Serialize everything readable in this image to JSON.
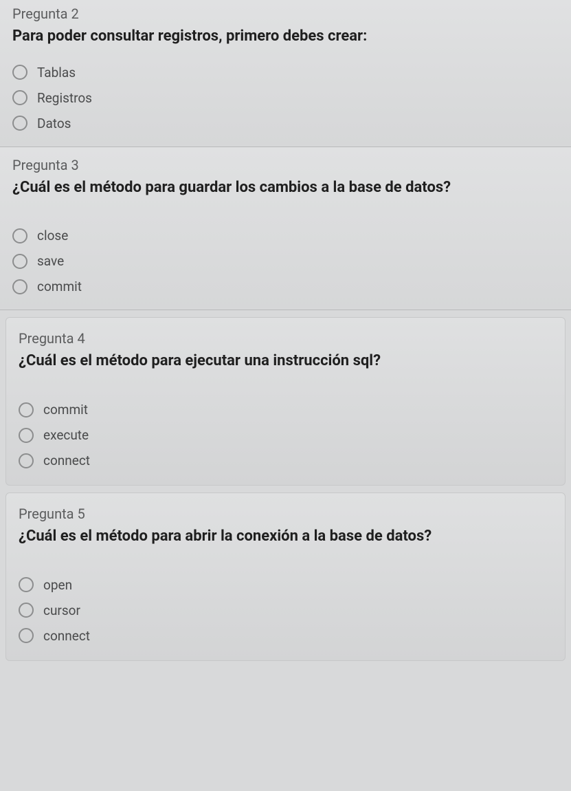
{
  "questions": [
    {
      "number": "Pregunta 2",
      "text": "Para poder consultar registros, primero debes crear:",
      "options": [
        "Tablas",
        "Registros",
        "Datos"
      ]
    },
    {
      "number": "Pregunta 3",
      "text": "¿Cuál es el método para guardar los cambios a la base de datos?",
      "options": [
        "close",
        "save",
        "commit"
      ]
    },
    {
      "number": "Pregunta 4",
      "text": "¿Cuál es el método para ejecutar una instrucción sql?",
      "options": [
        "commit",
        "execute",
        "connect"
      ]
    },
    {
      "number": "Pregunta 5",
      "text": "¿Cuál es el método para abrir la conexión a la base de datos?",
      "options": [
        "open",
        "cursor",
        "connect"
      ]
    }
  ]
}
